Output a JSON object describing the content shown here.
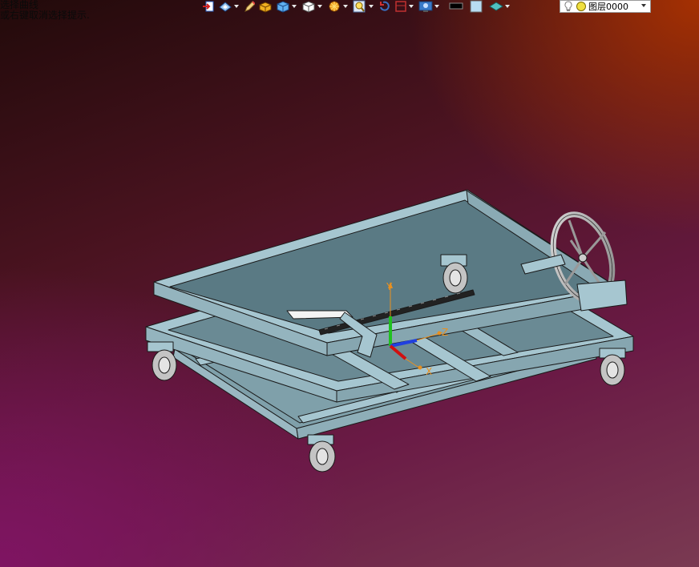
{
  "hints": {
    "line1": "选择曲线",
    "line2": "或右键取消选择提示."
  },
  "toolbar": {
    "buttons": [
      {
        "icon": "exit-sketch-icon",
        "has_dropdown": false
      },
      {
        "icon": "view-orient-icon",
        "has_dropdown": true
      },
      {
        "icon": "pen-edit-icon",
        "has_dropdown": false
      },
      {
        "icon": "solid-box-icon",
        "has_dropdown": false
      },
      {
        "icon": "shaded-cube-icon",
        "has_dropdown": true
      },
      {
        "icon": "wireframe-cube-icon",
        "has_dropdown": true
      },
      {
        "icon": "section-view-icon",
        "has_dropdown": true
      },
      {
        "icon": "zoom-icon",
        "has_dropdown": true
      },
      {
        "icon": "rotate-icon",
        "has_dropdown": false
      },
      {
        "icon": "display-filter-icon",
        "has_dropdown": true
      },
      {
        "icon": "render-icon",
        "has_dropdown": true
      },
      {
        "icon": "line-color-icon",
        "has_dropdown": false
      },
      {
        "icon": "face-color-icon",
        "has_dropdown": false
      },
      {
        "icon": "material-icon",
        "has_dropdown": true
      }
    ]
  },
  "layer": {
    "name": "图层0000",
    "icons": [
      "bulb-icon",
      "layer-color-icon"
    ]
  },
  "triad": {
    "x_label": "X",
    "y_label": "Y",
    "z_label": "Z"
  },
  "colors": {
    "part": "#a6c6d0",
    "edge": "#1a1a1a",
    "axis_x": "#d01010",
    "axis_y": "#20c020",
    "axis_z": "#2040e0",
    "axis_label": "#e89020"
  }
}
